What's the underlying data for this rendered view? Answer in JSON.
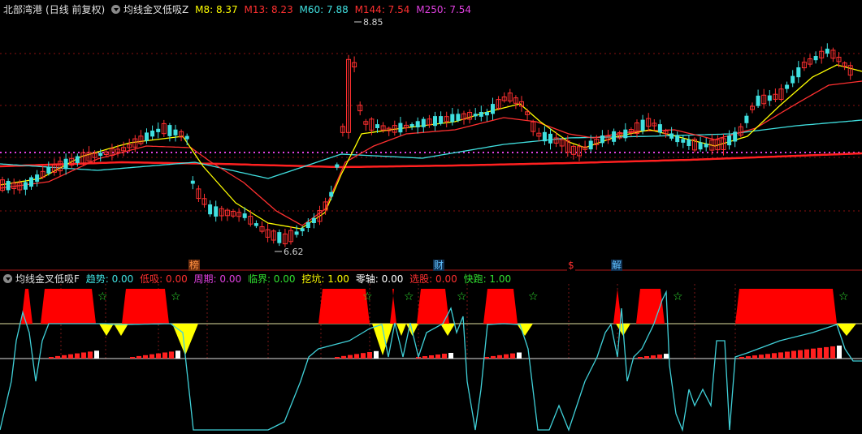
{
  "main_header": {
    "stock": "北部湾港",
    "period": "(日线 前复权)",
    "indicator": "均线金叉低吸Z",
    "ma": [
      {
        "label": "M8: 8.37",
        "color": "#ffff00"
      },
      {
        "label": "M13: 8.23",
        "color": "#ff3030"
      },
      {
        "label": "M60: 7.88",
        "color": "#40e0e0"
      },
      {
        "label": "M144: 7.54",
        "color": "#ff3030"
      },
      {
        "label": "M250: 7.54",
        "color": "#e040e0"
      }
    ]
  },
  "price_labels": {
    "high": "8.85",
    "low": "6.62"
  },
  "news_markers": [
    {
      "text": "榜",
      "color": "#ff9040",
      "bg": "#703010"
    },
    {
      "text": "财",
      "color": "#60c0ff",
      "bg": "#103050"
    },
    {
      "text": "$",
      "color": "#ff3030",
      "bg": "#000000"
    },
    {
      "text": "解",
      "color": "#60c0ff",
      "bg": "#103050"
    }
  ],
  "sub_header": {
    "indicator": "均线金叉低吸F",
    "items": [
      {
        "label": "趋势: 0.00",
        "color": "#40e0e0"
      },
      {
        "label": "低吸: 0.00",
        "color": "#ff3030"
      },
      {
        "label": "周期: 0.00",
        "color": "#e040e0"
      },
      {
        "label": "临界: 0.00",
        "color": "#30e030"
      },
      {
        "label": "挖坑: 1.00",
        "color": "#ffff00"
      },
      {
        "label": "零轴: 0.00",
        "color": "#ffffff"
      },
      {
        "label": "选股: 0.00",
        "color": "#ff3030"
      },
      {
        "label": "快跑: 1.00",
        "color": "#30e030"
      }
    ]
  },
  "star_glyph": "☆",
  "colors": {
    "up": "#ff3030",
    "down": "#40e0e0",
    "ma8": "#ffff00",
    "ma13": "#ff3030",
    "ma60": "#40e0e0",
    "ma144": "#ff2020",
    "ma250": "#e040e0",
    "signal": "#ff0000",
    "warn": "#ffff00",
    "star": "#30e030"
  }
}
